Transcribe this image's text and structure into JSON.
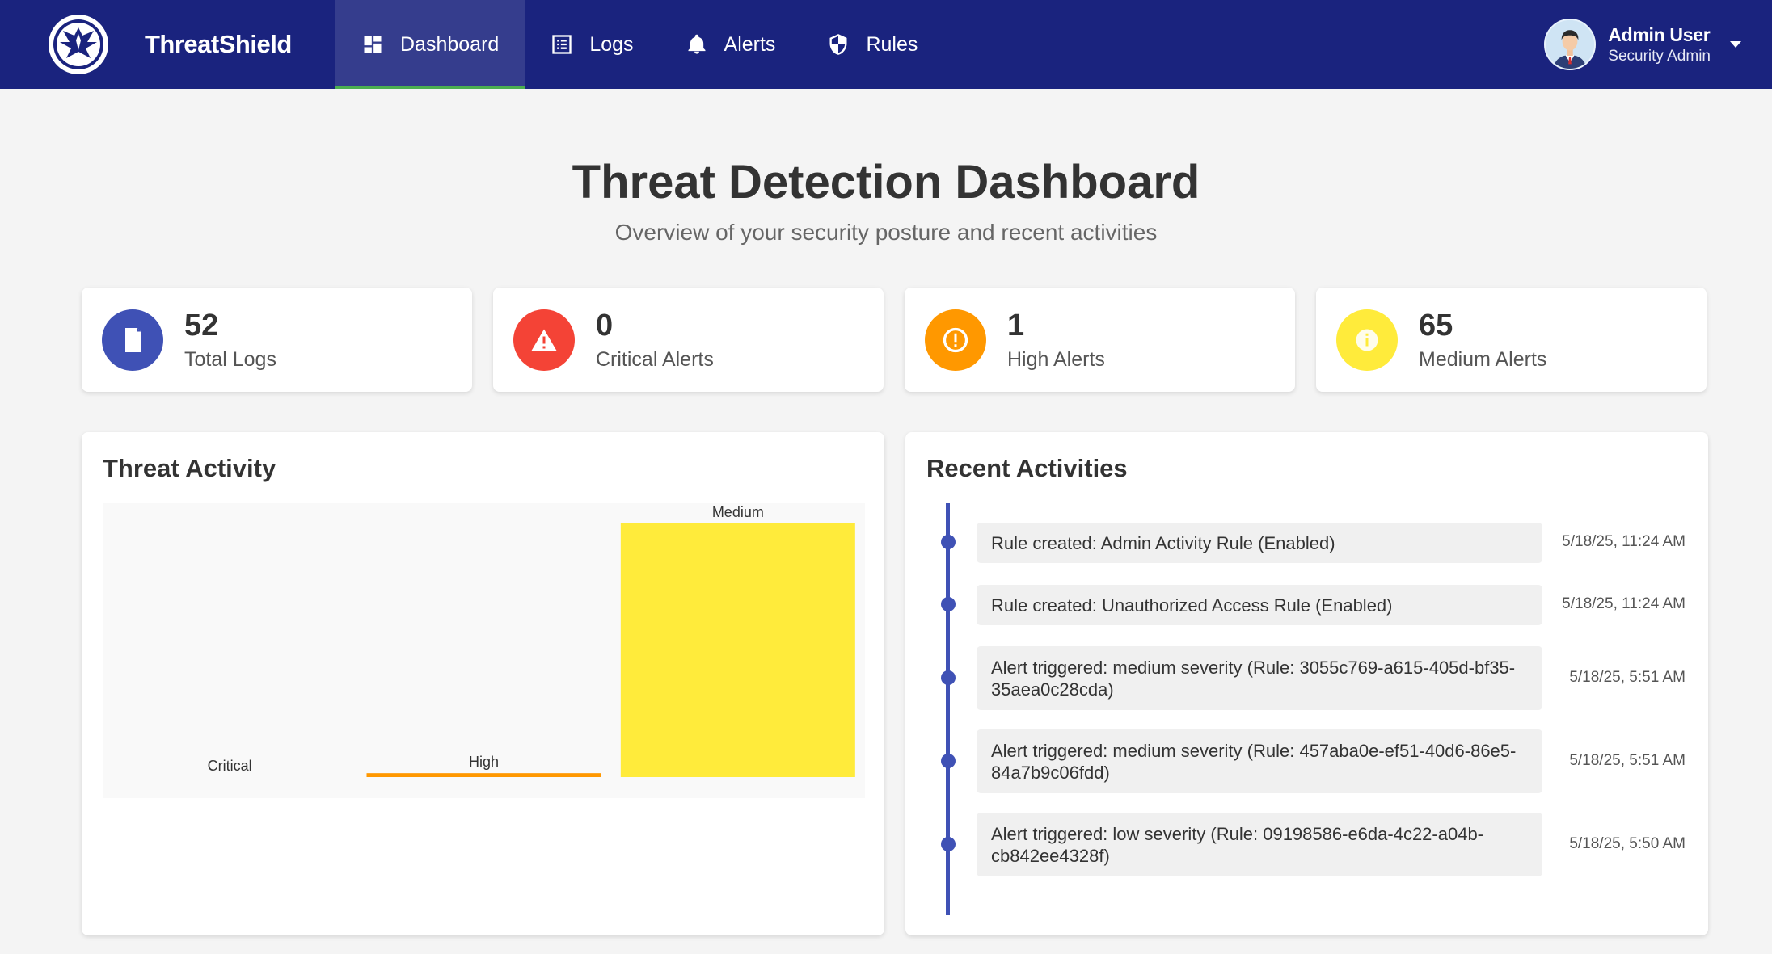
{
  "brand": {
    "name": "ThreatShield",
    "logo_icon": "eagle-shield-icon"
  },
  "nav": {
    "items": [
      {
        "label": "Dashboard",
        "icon": "dashboard-icon",
        "active": true
      },
      {
        "label": "Logs",
        "icon": "list-icon",
        "active": false
      },
      {
        "label": "Alerts",
        "icon": "bell-icon",
        "active": false
      },
      {
        "label": "Rules",
        "icon": "shield-icon",
        "active": false
      }
    ]
  },
  "user": {
    "name": "Admin User",
    "role": "Security Admin",
    "avatar_icon": "user-avatar-icon",
    "menu_icon": "caret-down-icon"
  },
  "header": {
    "title": "Threat Detection Dashboard",
    "subtitle": "Overview of your security posture and recent activities"
  },
  "stats": [
    {
      "value": "52",
      "label": "Total Logs",
      "icon": "document-icon",
      "color": "#3f51b5"
    },
    {
      "value": "0",
      "label": "Critical Alerts",
      "icon": "warning-triangle-icon",
      "color": "#f44336"
    },
    {
      "value": "1",
      "label": "High Alerts",
      "icon": "exclamation-circle-icon",
      "color": "#ff9800"
    },
    {
      "value": "65",
      "label": "Medium Alerts",
      "icon": "info-circle-icon",
      "color": "#ffeb3b"
    }
  ],
  "threat_activity": {
    "title": "Threat Activity"
  },
  "chart_data": {
    "type": "bar",
    "categories": [
      "Critical",
      "High",
      "Medium"
    ],
    "values": [
      0,
      1,
      65
    ],
    "colors": [
      "#f44336",
      "#ff9800",
      "#ffeb3b"
    ],
    "title": "",
    "xlabel": "",
    "ylabel": "",
    "ylim": [
      0,
      65
    ],
    "grid": false,
    "category_label_position": "above-bar"
  },
  "recent": {
    "title": "Recent Activities",
    "items": [
      {
        "text": "Rule created: Admin Activity Rule (Enabled)",
        "time": "5/18/25, 11:24 AM"
      },
      {
        "text": "Rule created: Unauthorized Access Rule (Enabled)",
        "time": "5/18/25, 11:24 AM"
      },
      {
        "text": "Alert triggered: medium severity (Rule: 3055c769-a615-405d-bf35-35aea0c28cda)",
        "time": "5/18/25, 5:51 AM"
      },
      {
        "text": "Alert triggered: medium severity (Rule: 457aba0e-ef51-40d6-86e5-84a7b9c06fdd)",
        "time": "5/18/25, 5:51 AM"
      },
      {
        "text": "Alert triggered: low severity (Rule: 09198586-e6da-4c22-a04b-cb842ee4328f)",
        "time": "5/18/25, 5:50 AM"
      }
    ]
  }
}
